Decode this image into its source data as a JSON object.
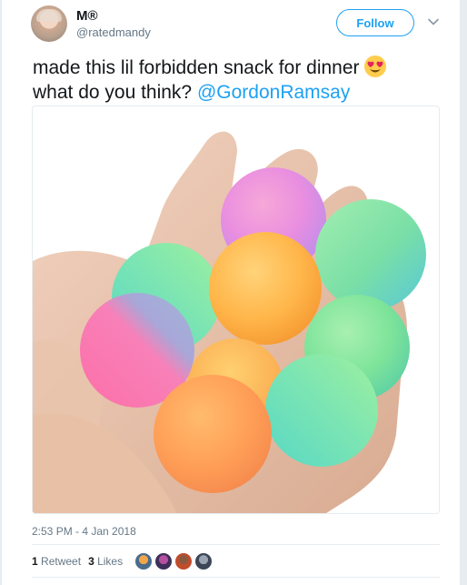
{
  "tweet": {
    "display_name": "M®",
    "handle": "@ratedmandy",
    "follow_label": "Follow",
    "text_line1": "made this lil forbidden snack for dinner",
    "text_line2": "what do you think?",
    "mention": "@GordonRamsay",
    "emoji_icon": "heart-eyes-emoji-icon",
    "image_icon": "bouncy-balls-in-hand-image",
    "timestamp": "2:53 PM - 4 Jan 2018",
    "retweet_count": "1",
    "retweet_label": "Retweet",
    "like_count": "3",
    "like_label": "Likes"
  },
  "colors": {
    "accent": "#1da1f2",
    "text": "#14171a",
    "muted": "#657786",
    "border": "#e6ecf0"
  }
}
